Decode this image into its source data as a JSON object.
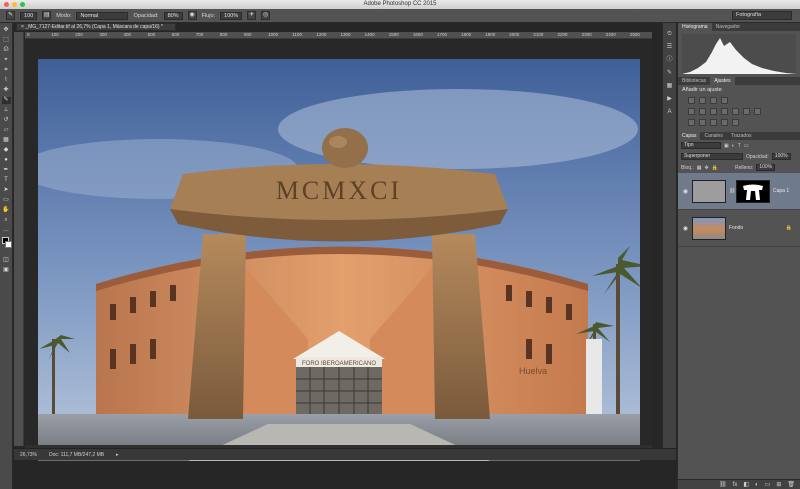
{
  "app": {
    "title": "Adobe Photoshop CC 2015"
  },
  "options": {
    "mode_label": "Modo:",
    "mode_value": "Normal",
    "opacity_label": "Opacidad:",
    "opacity_value": "80%",
    "flow_label": "Flujo:",
    "flow_value": "100%",
    "brush_size": "100",
    "workspace": "Fotografía"
  },
  "document": {
    "tab_title": "_MG_7127-Editar.tif al 26,7% (Capa 1, Máscara de capa/16) *",
    "zoom": "26,73%",
    "doc_info": "Doc: 111,7 MB/247,2 MB",
    "ruler_ticks": [
      "0",
      "100",
      "200",
      "300",
      "400",
      "500",
      "600",
      "700",
      "800",
      "900",
      "1000",
      "1100",
      "1200",
      "1300",
      "1400",
      "1500",
      "1600",
      "1700",
      "1800",
      "1900",
      "2000",
      "2100",
      "2200",
      "2300",
      "2400",
      "2500"
    ]
  },
  "photo": {
    "arch_inscription": "MCMXCI",
    "building_sign": "FORO IBEROAMERICANO",
    "wall_text": "Huelva"
  },
  "panels": {
    "top_tabs": [
      "Histograma",
      "Navegador"
    ],
    "mid_tabs": [
      "Bibliotecas",
      "Ajustes"
    ],
    "adjust_title": "Añadir un ajuste",
    "layer_tabs": [
      "Capas",
      "Canales",
      "Trazados"
    ],
    "kind_filter": "Tipo",
    "blend_mode": "Superponer",
    "opacity_label": "Opacidad:",
    "opacity_value": "100%",
    "lock_label": "Bloq.:",
    "fill_label": "Relleno:",
    "fill_value": "100%",
    "layers": [
      {
        "name": "Capa 1"
      },
      {
        "name": "Fondo"
      }
    ]
  },
  "colors": {
    "layer_selected": "#6f7b8c",
    "chrome": "#535353",
    "canvas_bg": "#282828"
  }
}
